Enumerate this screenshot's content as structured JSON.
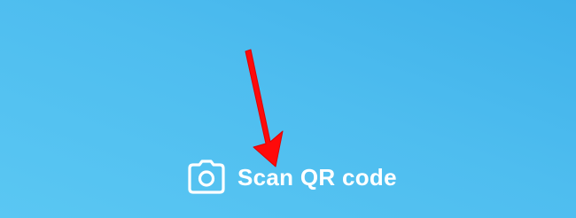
{
  "screen": {
    "background_gradient": [
      "#3fb1ea",
      "#5ac7f3"
    ]
  },
  "scan_action": {
    "icon": "camera-icon",
    "label": "Scan QR code",
    "color": "#ffffff"
  },
  "annotation": {
    "icon": "red-arrow-icon",
    "color": "#ff0a0a"
  }
}
